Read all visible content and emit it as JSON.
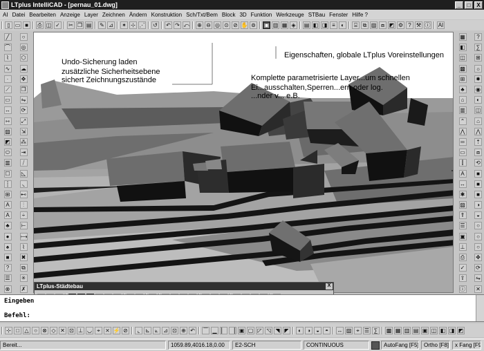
{
  "window": {
    "title": "LTplus IntelliCAD - [pernau_01.dwg]",
    "min": "_",
    "max": "□",
    "close": "X"
  },
  "menu": [
    "AI",
    "Datei",
    "Bearbeiten",
    "Anzeige",
    "Layer",
    "Zeichnen",
    "Ändern",
    "Konstruktion",
    "Sch/Txt/Bem",
    "Block",
    "3D",
    "Funktion",
    "Werkzeuge",
    "STBau",
    "Fenster",
    "Hilfe ?"
  ],
  "toolbar_top": {
    "right_label": "AI"
  },
  "annotations": {
    "undo_line1": "Undo-Sicherung laden",
    "undo_line2": "zusätzliche Sicherheitsebene",
    "undo_line3": "sichert Zeichnungszustände",
    "props": "Eigenschaften, globale LTplus Voreinstellungen",
    "param_line1": "Komplette parametrisierte Layer...um schnellen",
    "param_line2": "Ei...ausschalten,Sperren...ern oder log.",
    "param_line3": "...nder v...                   e.B."
  },
  "palette": {
    "title": "LTplus-Städtebau",
    "close": "X"
  },
  "command": {
    "line1": "Eingeben",
    "line2": "Befehl:"
  },
  "status": {
    "ready": "Bereit...",
    "coords": "1059.89,4016.18,0.00",
    "layer": "E2-SCH",
    "linetype": "CONTINUOUS",
    "snap": "AutoFang [F5]",
    "ortho": "Ortho [F8]",
    "grid": "x Fang [F9]"
  },
  "colors": {
    "titlebar": "#1f1f1f",
    "canvas": "#ffffff",
    "chrome": "#c6c6c6"
  }
}
